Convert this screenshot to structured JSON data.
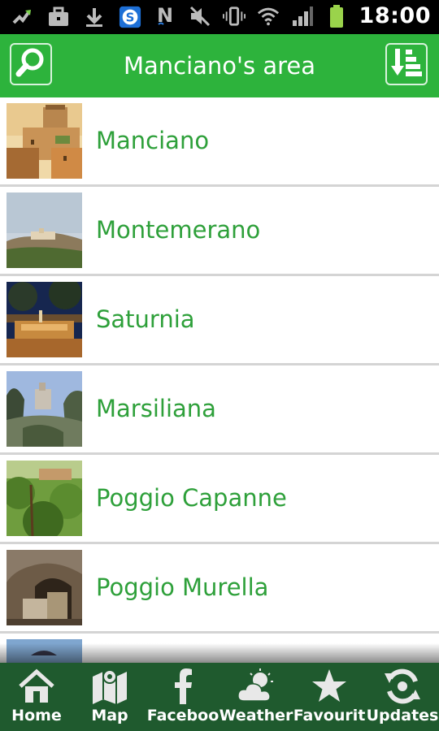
{
  "status_bar": {
    "time": "18:00",
    "icons": [
      "usb-debug-icon",
      "briefcase-icon",
      "download-icon",
      "skype-icon",
      "nfc-icon",
      "mute-icon",
      "vibrate-icon",
      "wifi-icon",
      "signal-icon",
      "battery-icon"
    ]
  },
  "header": {
    "title": "Manciano's area",
    "search_icon": "search-icon",
    "sort_icon": "sort-list-icon",
    "accent": "#2db33c"
  },
  "list": {
    "items": [
      {
        "label": "Manciano",
        "thumb": "town-tower"
      },
      {
        "label": "Montemerano",
        "thumb": "hill-village"
      },
      {
        "label": "Saturnia",
        "thumb": "night-fountain"
      },
      {
        "label": "Marsiliana",
        "thumb": "castle-trees"
      },
      {
        "label": "Poggio Capanne",
        "thumb": "green-valley"
      },
      {
        "label": "Poggio Murella",
        "thumb": "stone-cave"
      },
      {
        "label": "",
        "thumb": "partial-sky"
      }
    ],
    "text_color": "#2ea03a"
  },
  "tabs": [
    {
      "label": "Home",
      "icon": "home-icon"
    },
    {
      "label": "Map",
      "icon": "map-icon"
    },
    {
      "label": "Faceboo",
      "icon": "facebook-icon"
    },
    {
      "label": "Weather",
      "icon": "weather-icon"
    },
    {
      "label": "Favourit",
      "icon": "star-icon"
    },
    {
      "label": "Updates",
      "icon": "refresh-icon"
    }
  ]
}
